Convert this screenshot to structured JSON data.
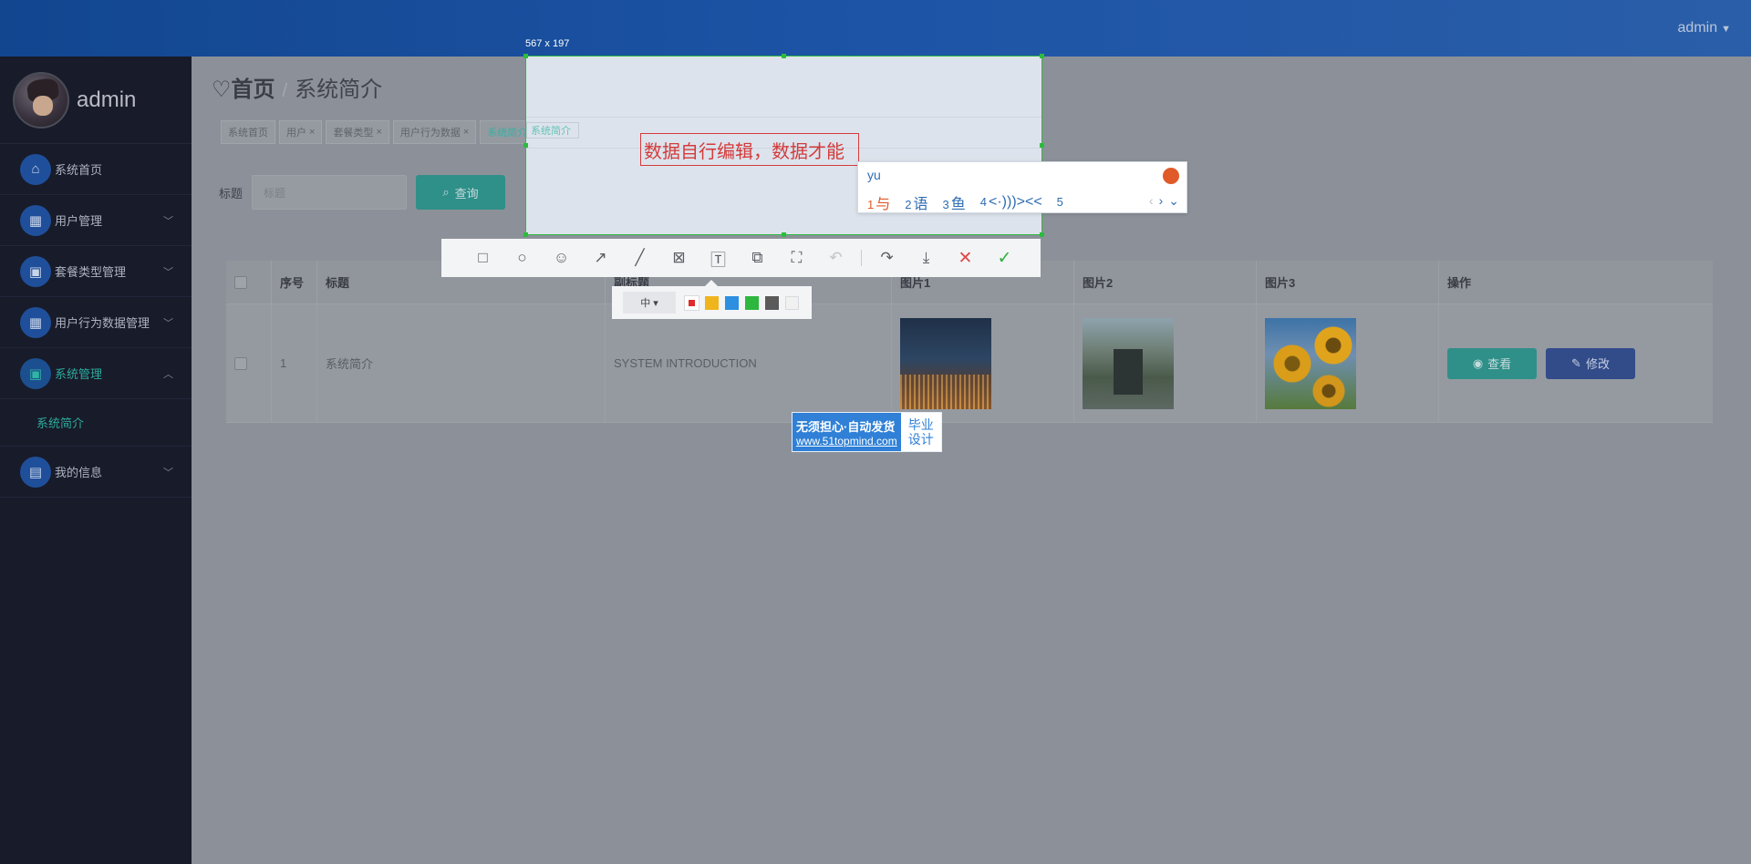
{
  "header": {
    "user": "admin"
  },
  "sidebar": {
    "brand_name": "admin",
    "items": [
      {
        "label": "系统首页",
        "icon": "home-icon",
        "has_arrow": false
      },
      {
        "label": "用户管理",
        "icon": "grid-icon",
        "has_arrow": true
      },
      {
        "label": "套餐类型管理",
        "icon": "clipboard-icon",
        "has_arrow": true
      },
      {
        "label": "用户行为数据管理",
        "icon": "grid-icon",
        "has_arrow": true
      },
      {
        "label": "系统管理",
        "icon": "clipboard-icon",
        "has_arrow": true,
        "active": true
      },
      {
        "label": "我的信息",
        "icon": "wallet-icon",
        "has_arrow": true
      }
    ],
    "submenu": [
      {
        "label": "系统简介"
      }
    ]
  },
  "main": {
    "breadcrumb": {
      "home": "首页",
      "current": "系统简介"
    },
    "tags": [
      {
        "label": "系统首页",
        "closable": false
      },
      {
        "label": "用户",
        "closable": true
      },
      {
        "label": "套餐类型",
        "closable": true
      },
      {
        "label": "用户行为数据",
        "closable": true
      },
      {
        "label": "系统简介",
        "closable": true,
        "active": true
      }
    ],
    "search": {
      "label": "标题",
      "placeholder": "标题",
      "button": "查询"
    },
    "table": {
      "headers": [
        "",
        "序号",
        "标题",
        "副标题",
        "图片1",
        "图片2",
        "图片3",
        "操作"
      ],
      "rows": [
        {
          "index": "1",
          "title": "系统简介",
          "subtitle": "SYSTEM INTRODUCTION",
          "view": "查看",
          "edit": "修改"
        }
      ]
    }
  },
  "capture": {
    "size_label": "567 x 197",
    "text": "数据自行编辑，数据才能",
    "ime": {
      "pinyin": "yu",
      "candidates": [
        {
          "n": "1",
          "text": "与"
        },
        {
          "n": "2",
          "text": "语"
        },
        {
          "n": "3",
          "text": "鱼"
        },
        {
          "n": "4",
          "text": "<·)))><<"
        },
        {
          "n": "5",
          "text": ""
        }
      ]
    },
    "tools": [
      "rectangle-icon",
      "ellipse-icon",
      "emoji-icon",
      "arrow-icon",
      "line-icon",
      "mosaic-icon",
      "text-icon",
      "pin-icon",
      "ocr-icon",
      "undo-icon",
      "share-icon",
      "save-icon",
      "close-icon",
      "confirm-icon"
    ],
    "size_option": "中",
    "colors": [
      "#e02b2b",
      "#f0b41c",
      "#2c8fe0",
      "#2db73e",
      "#5a5a5a",
      "#f1f1f1"
    ]
  },
  "watermark": {
    "line1": "无须担心·自动发货",
    "line2": "www.51topmind.com",
    "badge1": "毕业",
    "badge2": "设计"
  }
}
